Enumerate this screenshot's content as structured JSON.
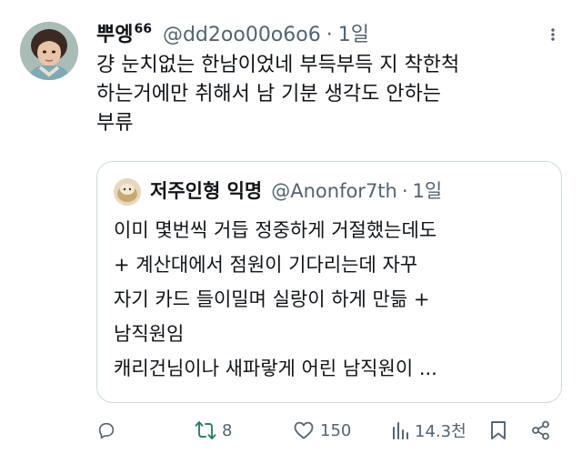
{
  "tweet": {
    "author_name": "뿌엥",
    "author_name_suffix": "66",
    "handle": "@dd2oo00o6o6",
    "separator": "·",
    "time": "1일",
    "lines": [
      "걍 눈치없는 한남이었네 부득부득 지 착한척",
      "하는거에만 취해서 남 기분 생각도 안하는",
      "부류"
    ]
  },
  "quote": {
    "author_name": "저주인형 익명",
    "handle": "@Anonfor7th",
    "separator": "·",
    "time": "1일",
    "lines": [
      "이미 몇번씩 거듭 정중하게 거절했는데도",
      "+ 계산대에서 점원이 기다리는데 자꾸",
      "자기 카드 들이밀며 실랑이 하게 만듦 +",
      "남직원임",
      "캐리건님이나 새파랗게 어린 남직원이 ..."
    ]
  },
  "actions": {
    "reply_count": "",
    "retweet_count": "8",
    "like_count": "150",
    "view_count": "14.3천"
  },
  "icons": {
    "more": "more-icon",
    "reply": "reply-icon",
    "retweet": "retweet-icon",
    "like": "heart-icon",
    "views": "views-icon",
    "bookmark": "bookmark-icon",
    "share": "share-icon"
  },
  "colors": {
    "text": "#0f1419",
    "secondary": "#536471",
    "border": "#cfd9de",
    "retweet_icon": "#2e7d6b"
  }
}
